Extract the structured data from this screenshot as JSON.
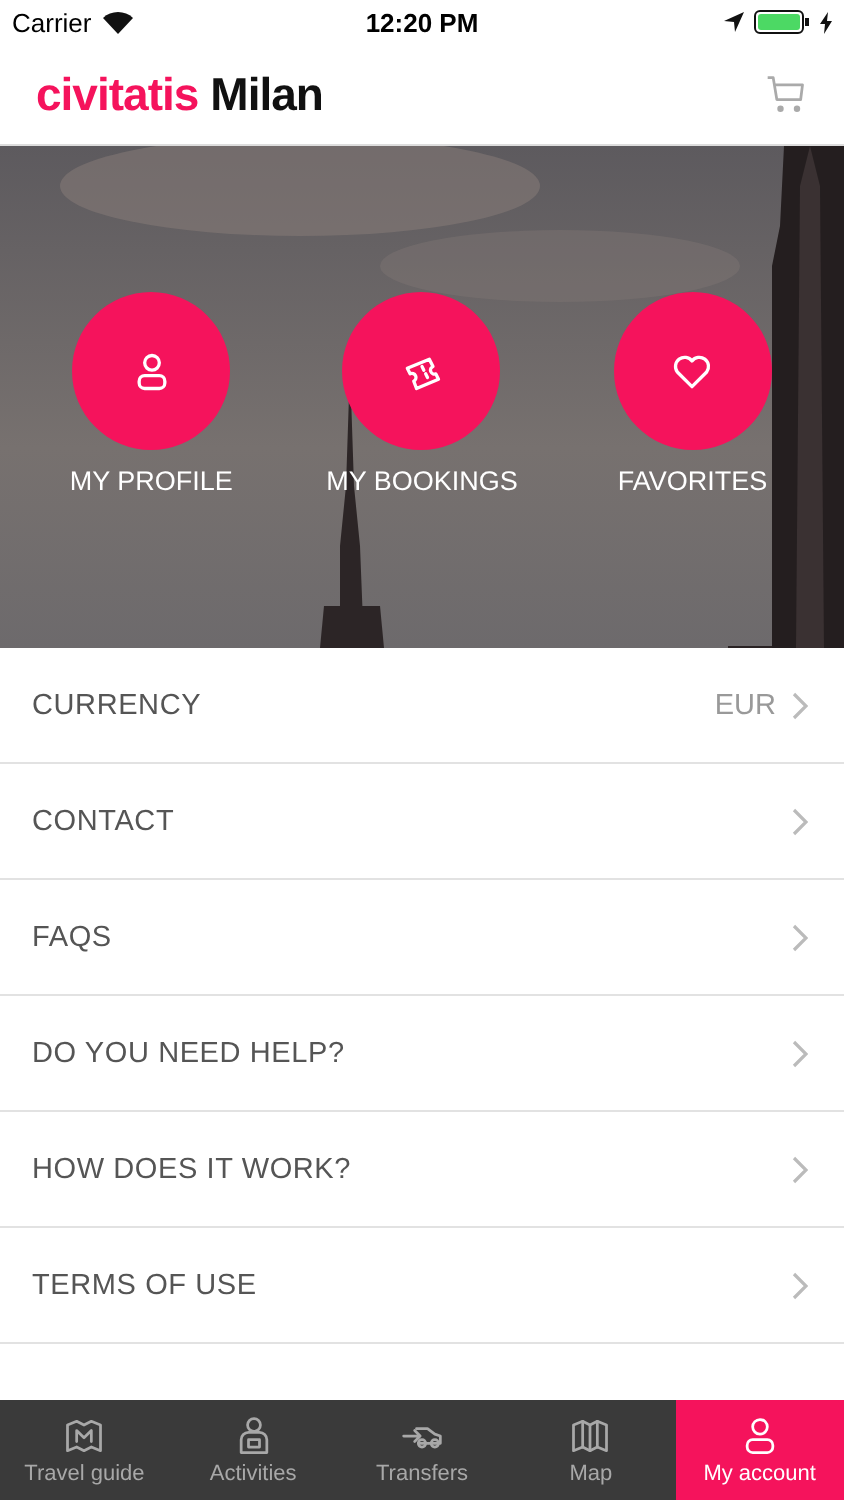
{
  "status_bar": {
    "carrier": "Carrier",
    "time": "12:20 PM"
  },
  "header": {
    "brand": "civitatis",
    "city": "Milan"
  },
  "hero": {
    "kind": "picture",
    "actions": [
      {
        "label": "MY PROFILE"
      },
      {
        "label": "MY BOOKINGS"
      },
      {
        "label": "FAVORITES"
      }
    ]
  },
  "menu": [
    {
      "label": "CURRENCY",
      "value": "EUR"
    },
    {
      "label": "CONTACT"
    },
    {
      "label": "FAQS"
    },
    {
      "label": "DO YOU NEED HELP?"
    },
    {
      "label": "HOW DOES IT WORK?"
    },
    {
      "label": "TERMS OF USE"
    }
  ],
  "tab_bar": [
    {
      "label": "Travel guide",
      "selected": false
    },
    {
      "label": "Activities",
      "selected": false
    },
    {
      "label": "Transfers",
      "selected": false
    },
    {
      "label": "Map",
      "selected": false
    },
    {
      "label": "My account",
      "selected": true
    }
  ]
}
